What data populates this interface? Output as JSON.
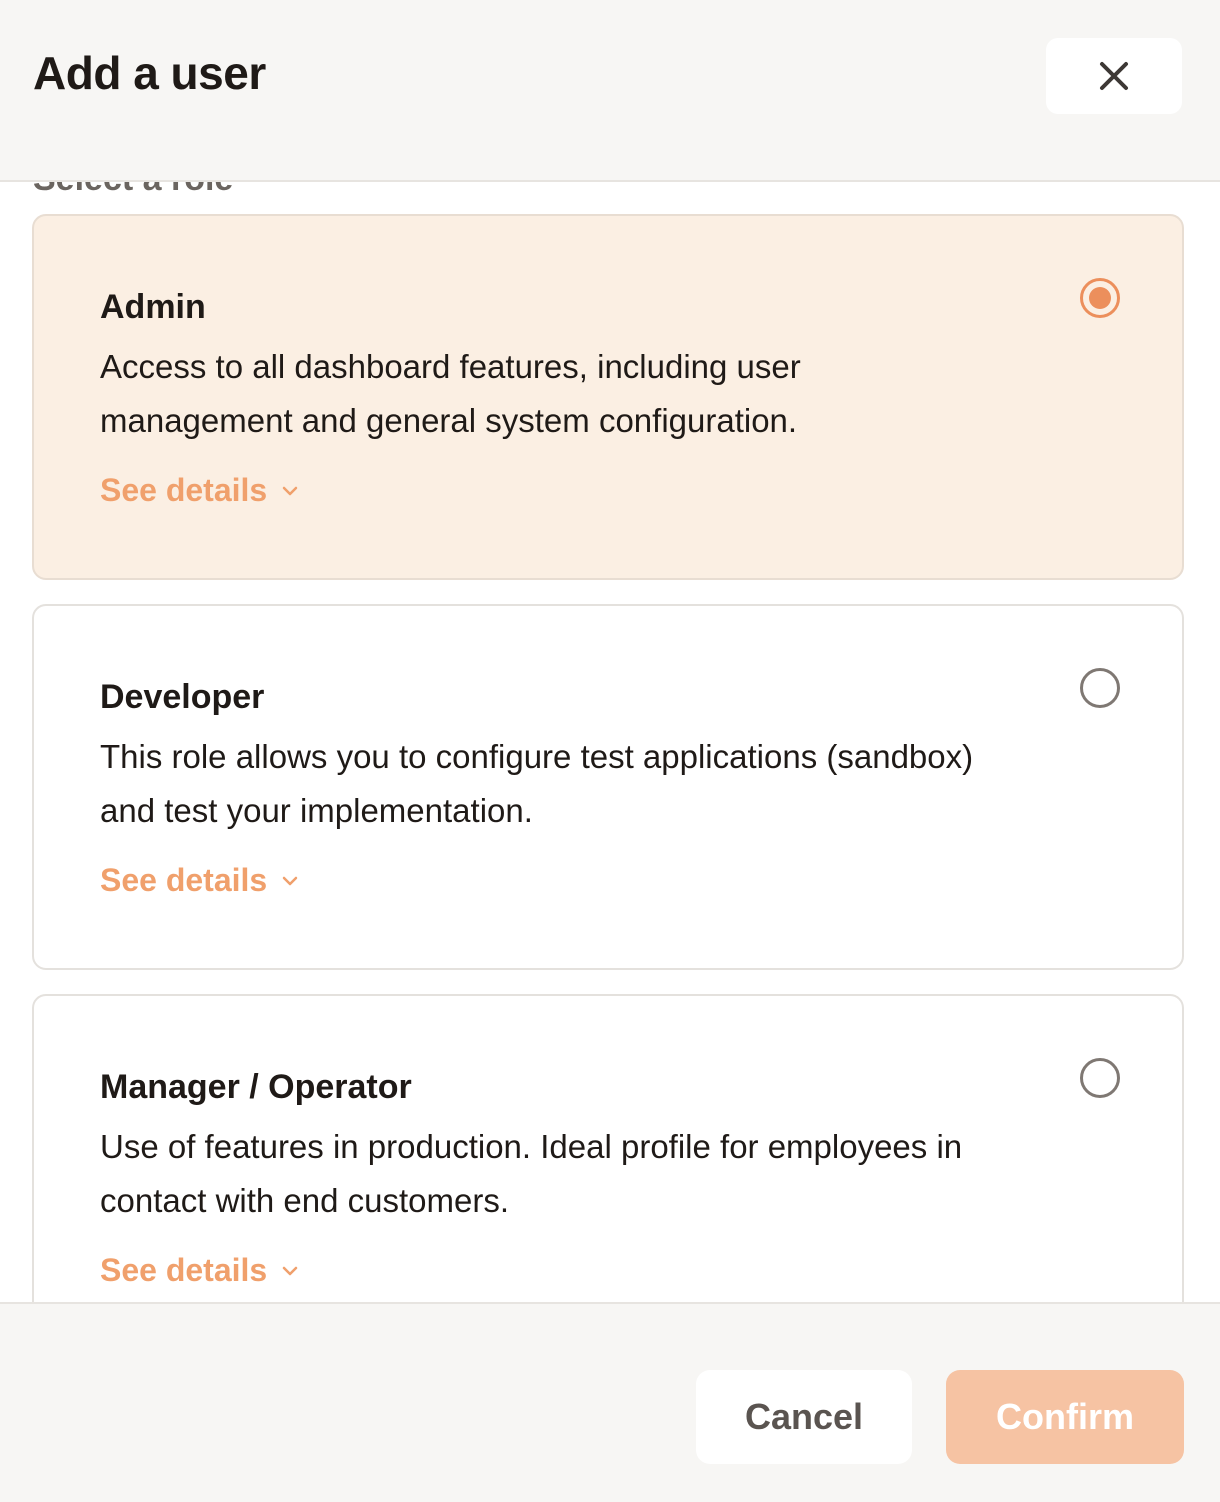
{
  "header": {
    "title": "Add a user"
  },
  "section_label": "Select a role",
  "roles": [
    {
      "name": "Admin",
      "description": "Access to all dashboard features, including user management and general system configuration.",
      "details_label": "See details",
      "selected": true
    },
    {
      "name": "Developer",
      "description": "This role allows you to configure test applications (sandbox) and test your implementation.",
      "details_label": "See details",
      "selected": false
    },
    {
      "name": "Manager / Operator",
      "description": "Use of features in production. Ideal profile for employees in contact with end customers.",
      "details_label": "See details",
      "selected": false
    }
  ],
  "footer": {
    "cancel_label": "Cancel",
    "confirm_label": "Confirm"
  },
  "icons": {
    "close": "close-icon",
    "chevron": "chevron-down-icon"
  },
  "colors": {
    "accent": "#ec8f5c",
    "link": "#f0a06c",
    "selected_bg": "#fbefe3",
    "confirm_disabled": "#f6c3a3"
  }
}
